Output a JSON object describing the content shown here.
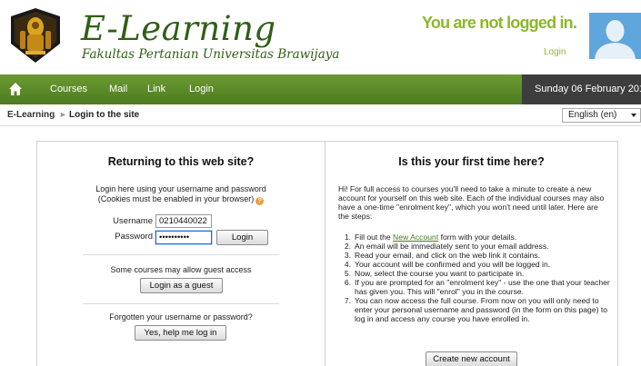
{
  "header": {
    "title": "E-Learning",
    "subtitle": "Fakultas Pertanian Universitas Brawijaya",
    "login_status": "You are not logged in.",
    "login_link": "Login"
  },
  "nav": {
    "items": [
      "Courses",
      "Mail",
      "Link",
      "Login"
    ],
    "date": "Sunday 06 February 201"
  },
  "breadcrumb": {
    "home": "E-Learning",
    "separator": "►",
    "current": "Login to the site"
  },
  "language": {
    "selected": "English (en)"
  },
  "login_panel": {
    "heading": "Returning to this web site?",
    "desc_line1": "Login here using your username and password",
    "desc_line2": "(Cookies must be enabled in your browser)",
    "username_label": "Username",
    "username_value": "0210440022",
    "password_label": "Password",
    "password_value": "••••••••••",
    "login_button": "Login",
    "guest_note": "Some courses may allow guest access",
    "guest_button": "Login as a guest",
    "forgot_note": "Forgotten your username or password?",
    "forgot_button": "Yes, help me log in"
  },
  "signup_panel": {
    "heading": "Is this your first time here?",
    "intro": "Hi! For full access to courses you'll need to take a minute to create a new account for yourself on this web site. Each of the individual courses may also have a one-time \"enrolment key\", which you won't need until later. Here are the steps:",
    "steps": [
      {
        "pre": "Fill out the ",
        "link": "New Account",
        "post": " form with your details."
      },
      {
        "pre": "An email will be immediately sent to your email address.",
        "link": "",
        "post": ""
      },
      {
        "pre": "Read your email, and click on the web link it contains.",
        "link": "",
        "post": ""
      },
      {
        "pre": "Your account will be confirmed and you will be logged in.",
        "link": "",
        "post": ""
      },
      {
        "pre": "Now, select the course you want to participate in.",
        "link": "",
        "post": ""
      },
      {
        "pre": "If you are prompted for an \"enrolment key\" - use the one that your teacher has given you. This will \"enrol\" you in the course.",
        "link": "",
        "post": ""
      },
      {
        "pre": "You can now access the full course. From now on you will only need to enter your personal username and password (in the form on this page) to log in and access any course you have enrolled in.",
        "link": "",
        "post": ""
      }
    ],
    "create_button": "Create new account"
  },
  "colors": {
    "brand_green": "#2f5f16",
    "accent_green": "#8bb82c",
    "nav_green": "#5a8a28",
    "date_bg": "#3d3d3d"
  },
  "icons": [
    "university-emblem-icon",
    "avatar-placeholder-icon",
    "home-icon",
    "help-icon",
    "dropdown-arrow-icon"
  ]
}
